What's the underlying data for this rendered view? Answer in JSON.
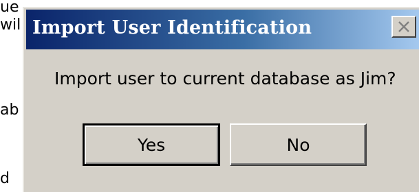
{
  "background": {
    "fragments": [
      "ue",
      "wil",
      "ab",
      "d"
    ]
  },
  "dialog": {
    "title": "Import User Identification",
    "close_icon": "close-icon",
    "message": "Import user to current database as Jim?",
    "buttons": {
      "yes": "Yes",
      "no": "No"
    },
    "colors": {
      "title_start": "#0a246a",
      "title_end": "#a6caf0",
      "face": "#d4d0c8"
    }
  }
}
